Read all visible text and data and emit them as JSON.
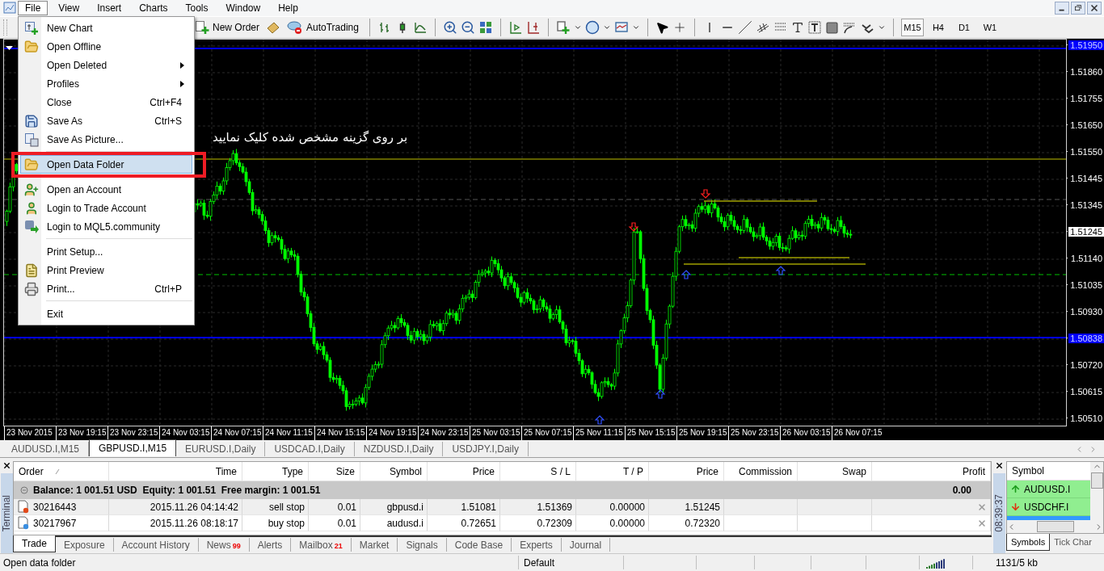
{
  "menu_bar": {
    "items": [
      {
        "label": "File",
        "selected": true
      },
      {
        "label": "View",
        "selected": false
      },
      {
        "label": "Insert",
        "selected": false
      },
      {
        "label": "Charts",
        "selected": false
      },
      {
        "label": "Tools",
        "selected": false
      },
      {
        "label": "Window",
        "selected": false
      },
      {
        "label": "Help",
        "selected": false
      }
    ]
  },
  "toolbar": {
    "buttons": [
      {
        "label": "New Order"
      },
      {
        "label": "AutoTrading"
      }
    ],
    "timeframes": [
      {
        "label": "M15",
        "selected": true
      },
      {
        "label": "H4",
        "selected": false
      },
      {
        "label": "D1",
        "selected": false
      },
      {
        "label": "W1",
        "selected": false
      }
    ]
  },
  "file_menu": {
    "items": [
      {
        "kind": "item",
        "label": "New Chart",
        "submenu": false,
        "selected": false
      },
      {
        "kind": "item",
        "label": "Open Offline",
        "submenu": false,
        "selected": false
      },
      {
        "kind": "item",
        "label": "Open Deleted",
        "submenu": true,
        "selected": false
      },
      {
        "kind": "item",
        "label": "Profiles",
        "submenu": true,
        "selected": false
      },
      {
        "kind": "item",
        "label": "Close",
        "shortcut": "Ctrl+F4",
        "submenu": false,
        "selected": false
      },
      {
        "kind": "item",
        "label": "Save As",
        "shortcut": "Ctrl+S",
        "submenu": false,
        "selected": false
      },
      {
        "kind": "item",
        "label": "Save As Picture...",
        "submenu": false,
        "selected": false
      },
      {
        "kind": "separator"
      },
      {
        "kind": "item",
        "label": "Open Data Folder",
        "submenu": false,
        "selected": true
      },
      {
        "kind": "separator"
      },
      {
        "kind": "item",
        "label": "Open an Account",
        "submenu": false,
        "selected": false
      },
      {
        "kind": "item",
        "label": "Login to Trade Account",
        "submenu": false,
        "selected": false
      },
      {
        "kind": "item",
        "label": "Login to MQL5.community",
        "submenu": false,
        "selected": false
      },
      {
        "kind": "separator"
      },
      {
        "kind": "item",
        "label": "Print Setup...",
        "submenu": false,
        "selected": false
      },
      {
        "kind": "item",
        "label": "Print Preview",
        "submenu": false,
        "selected": false
      },
      {
        "kind": "item",
        "label": "Print...",
        "shortcut": "Ctrl+P",
        "submenu": false,
        "selected": false
      },
      {
        "kind": "separator"
      },
      {
        "kind": "item",
        "label": "Exit",
        "submenu": false,
        "selected": false
      }
    ]
  },
  "chart": {
    "annotation": "بر روی گزینه مشخص شده کلیک نمایید",
    "price_axis": [
      {
        "kind": "level",
        "text": "1.51950"
      },
      {
        "kind": "tick",
        "text": "1.51860"
      },
      {
        "kind": "tick",
        "text": "1.51755"
      },
      {
        "kind": "tick",
        "text": "1.51650"
      },
      {
        "kind": "tick",
        "text": "1.51550"
      },
      {
        "kind": "tick",
        "text": "1.51445"
      },
      {
        "kind": "tick",
        "text": "1.51345"
      },
      {
        "kind": "current",
        "text": "1.51245"
      },
      {
        "kind": "tick",
        "text": "1.51140"
      },
      {
        "kind": "tick",
        "text": "1.51035"
      },
      {
        "kind": "tick",
        "text": "1.50930"
      },
      {
        "kind": "level",
        "text": "1.50838"
      },
      {
        "kind": "tick",
        "text": "1.50720"
      },
      {
        "kind": "tick",
        "text": "1.50615"
      },
      {
        "kind": "tick",
        "text": "1.50510"
      }
    ],
    "time_axis": [
      "23 Nov 2015",
      "23 Nov 19:15",
      "23 Nov 23:15",
      "24 Nov 03:15",
      "24 Nov 07:15",
      "24 Nov 11:15",
      "24 Nov 15:15",
      "24 Nov 19:15",
      "24 Nov 23:15",
      "25 Nov 03:15",
      "25 Nov 07:15",
      "25 Nov 11:15",
      "25 Nov 15:15",
      "25 Nov 19:15",
      "25 Nov 23:15",
      "26 Nov 03:15",
      "26 Nov 07:15"
    ]
  },
  "chart_tabs": [
    {
      "label": "AUDUSD.I,M15",
      "selected": false
    },
    {
      "label": "GBPUSD.I,M15",
      "selected": true
    },
    {
      "label": "EURUSD.I,Daily",
      "selected": false
    },
    {
      "label": "USDCAD.I,Daily",
      "selected": false
    },
    {
      "label": "NZDUSD.I,Daily",
      "selected": false
    },
    {
      "label": "USDJPY.I,Daily",
      "selected": false
    }
  ],
  "terminal": {
    "title": "Terminal",
    "columns": [
      "Order",
      "Time",
      "Type",
      "Size",
      "Symbol",
      "Price",
      "S / L",
      "T / P",
      "Price",
      "Commission",
      "Swap",
      "Profit"
    ],
    "balance": "Balance: 1 001.51 USD  Equity: 1 001.51  Free margin: 1 001.51",
    "balance_profit": "0.00",
    "orders": [
      {
        "kind": "sell",
        "cells": [
          "30216443",
          "2015.11.26 04:14:42",
          "sell stop",
          "0.01",
          "gbpusd.i",
          "1.51081",
          "1.51369",
          "0.00000",
          "1.51245"
        ]
      },
      {
        "kind": "buy",
        "cells": [
          "30217967",
          "2015.11.26 08:18:17",
          "buy stop",
          "0.01",
          "audusd.i",
          "0.72651",
          "0.72309",
          "0.00000",
          "0.72320"
        ]
      }
    ],
    "tabs": [
      {
        "label": "Trade",
        "selected": true
      },
      {
        "label": "Exposure",
        "selected": false
      },
      {
        "label": "Account History",
        "selected": false
      },
      {
        "label": "News",
        "badge": "99",
        "selected": false
      },
      {
        "label": "Alerts",
        "selected": false
      },
      {
        "label": "Mailbox",
        "badge": "21",
        "selected": false
      },
      {
        "label": "Market",
        "selected": false
      },
      {
        "label": "Signals",
        "selected": false
      },
      {
        "label": "Code Base",
        "selected": false
      },
      {
        "label": "Experts",
        "selected": false
      },
      {
        "label": "Journal",
        "selected": false
      }
    ]
  },
  "market_watch": {
    "header": "Symbol",
    "clock": "08:39:37",
    "symbols": [
      {
        "symbol": "AUDUSD.I",
        "rising": true
      },
      {
        "symbol": "USDCHF.I",
        "rising": false
      }
    ],
    "tabs": [
      {
        "label": "Symbols",
        "selected": true
      },
      {
        "label": "Tick Char",
        "selected": false
      }
    ]
  },
  "status_bar": {
    "message": "Open data folder",
    "profile": "Default",
    "traffic": "1131/5 kb"
  }
}
